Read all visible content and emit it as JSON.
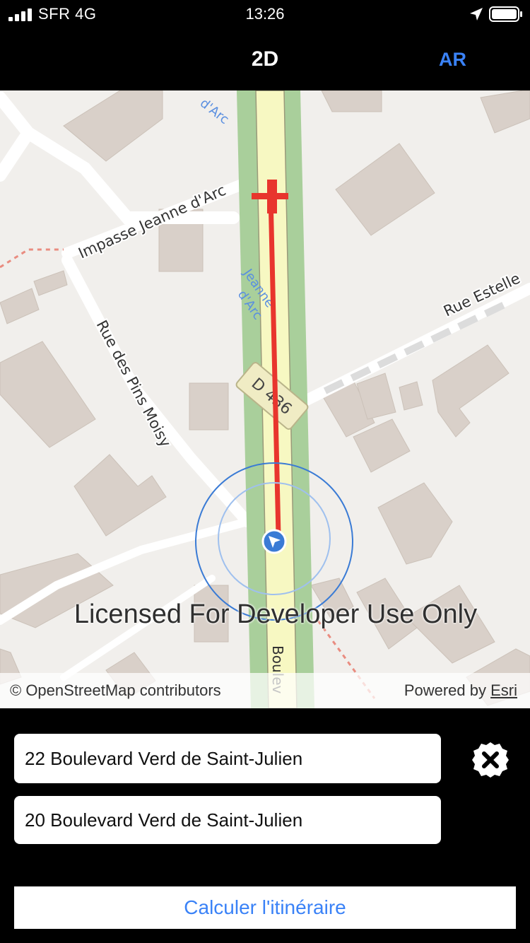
{
  "status_bar": {
    "carrier": "SFR 4G",
    "time": "13:26"
  },
  "navbar": {
    "title": "2D",
    "ar_label": "AR"
  },
  "map": {
    "labels": {
      "impasse": "Impasse Jeanne d'Arc",
      "rue_pins": "Rue des Pins Moisy",
      "rue_estelle": "Rue Estelle",
      "road_shield": "D 436",
      "jeanne_top": "d'Arc",
      "jeanne_mid_1": "Jeanne",
      "jeanne_mid_2": "d'Arc",
      "boulevard": "Boulev"
    },
    "watermark": "Licensed For Developer Use Only",
    "attribution_left": "© OpenStreetMap contributors",
    "attribution_powered": "Powered by ",
    "attribution_esri": "Esri",
    "colors": {
      "background": "#f1efec",
      "building": "#d9d0c9",
      "main_road": "#f7f8c2",
      "road_verge": "#a9cf9b",
      "route": "#e8352d",
      "location": "#3a7bd5"
    }
  },
  "panel": {
    "origin_value": "22 Boulevard Verd de Saint-Julien",
    "destination_value": "20 Boulevard Verd de Saint-Julien",
    "calculate_label": "Calculer l'itinéraire"
  },
  "icons": [
    "signal-icon",
    "location-arrow-icon",
    "battery-icon",
    "location-marker-icon",
    "destination-marker-icon",
    "clear-icon"
  ]
}
